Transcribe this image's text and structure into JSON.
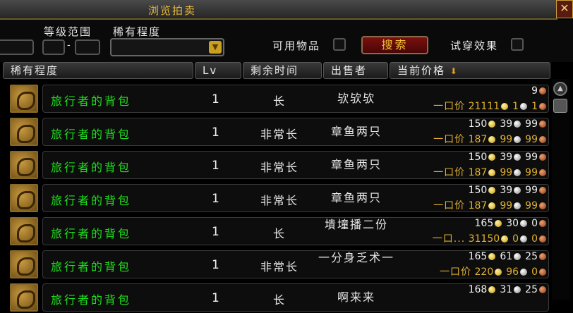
{
  "window": {
    "title": "浏览拍卖",
    "close_label": "✕"
  },
  "filters": {
    "level_label": "等级范围",
    "level_sep": "-",
    "rarity_label": "稀有程度",
    "usable_label": "可用物品",
    "search_label": "搜索",
    "tryon_label": "试穿效果"
  },
  "columns": {
    "rarity": "稀有程度",
    "lv": "Lv",
    "time": "剩余时间",
    "seller": "出售者",
    "price": "当前价格"
  },
  "buyout_label": "一口价",
  "rows": [
    {
      "name": "旅行者的背包",
      "lv": "1",
      "time": "长",
      "seller": "欤欤欤",
      "bid": {
        "g": "",
        "s": "",
        "c": "9"
      },
      "buy": {
        "label": "一口价",
        "g": "21111",
        "s": "1",
        "c": "1"
      }
    },
    {
      "name": "旅行者的背包",
      "lv": "1",
      "time": "非常长",
      "seller": "章鱼两只",
      "bid": {
        "g": "150",
        "s": "39",
        "c": "99"
      },
      "buy": {
        "label": "一口价",
        "g": "187",
        "s": "99",
        "c": "99"
      }
    },
    {
      "name": "旅行者的背包",
      "lv": "1",
      "time": "非常长",
      "seller": "章鱼两只",
      "bid": {
        "g": "150",
        "s": "39",
        "c": "99"
      },
      "buy": {
        "label": "一口价",
        "g": "187",
        "s": "99",
        "c": "99"
      }
    },
    {
      "name": "旅行者的背包",
      "lv": "1",
      "time": "非常长",
      "seller": "章鱼两只",
      "bid": {
        "g": "150",
        "s": "39",
        "c": "99"
      },
      "buy": {
        "label": "一口价",
        "g": "187",
        "s": "99",
        "c": "99"
      }
    },
    {
      "name": "旅行者的背包",
      "lv": "1",
      "time": "长",
      "seller": "墤墥播二份",
      "bid": {
        "g": "165",
        "s": "30",
        "c": "0"
      },
      "buy": {
        "label": "一口...",
        "g": "31150",
        "s": "0",
        "c": "0"
      }
    },
    {
      "name": "旅行者的背包",
      "lv": "1",
      "time": "非常长",
      "seller": "一分身乏术一",
      "bid": {
        "g": "165",
        "s": "61",
        "c": "25"
      },
      "buy": {
        "label": "一口价",
        "g": "220",
        "s": "96",
        "c": "0"
      }
    },
    {
      "name": "旅行者的背包",
      "lv": "1",
      "time": "长",
      "seller": "啊来来",
      "bid": {
        "g": "168",
        "s": "31",
        "c": "25"
      },
      "buy": {
        "label": "",
        "g": "",
        "s": "",
        "c": ""
      }
    }
  ]
}
